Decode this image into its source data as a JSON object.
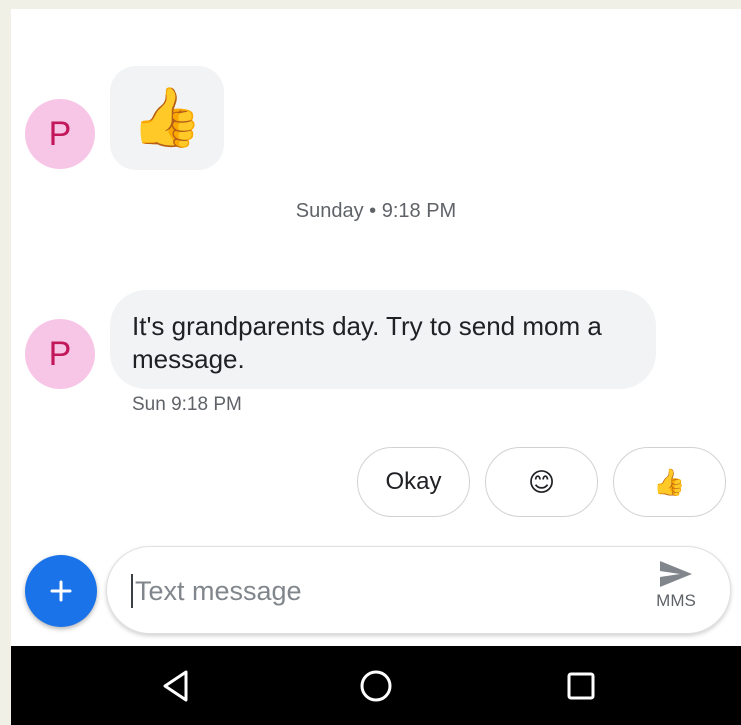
{
  "conversation": {
    "sender_initial": "P",
    "first_message_emoji": "👍",
    "date_separator": "Sunday • 9:18 PM",
    "second_message_text": "It's grandparents day. Try to send mom a message.",
    "second_message_time": "Sun 9:18 PM"
  },
  "smart_replies": [
    {
      "label": "Okay"
    },
    {
      "label": "😊"
    },
    {
      "label": "👍"
    }
  ],
  "compose": {
    "placeholder": "Text message",
    "send_label": "MMS",
    "add_icon": "plus-icon",
    "send_icon": "send-icon"
  },
  "navbar": {
    "icons": [
      "back-icon",
      "home-icon",
      "recents-icon"
    ]
  },
  "colors": {
    "avatar_bg": "#f7c6e6",
    "avatar_text": "#c2185b",
    "fab": "#1a73e8",
    "bubble": "#f1f3f4"
  }
}
